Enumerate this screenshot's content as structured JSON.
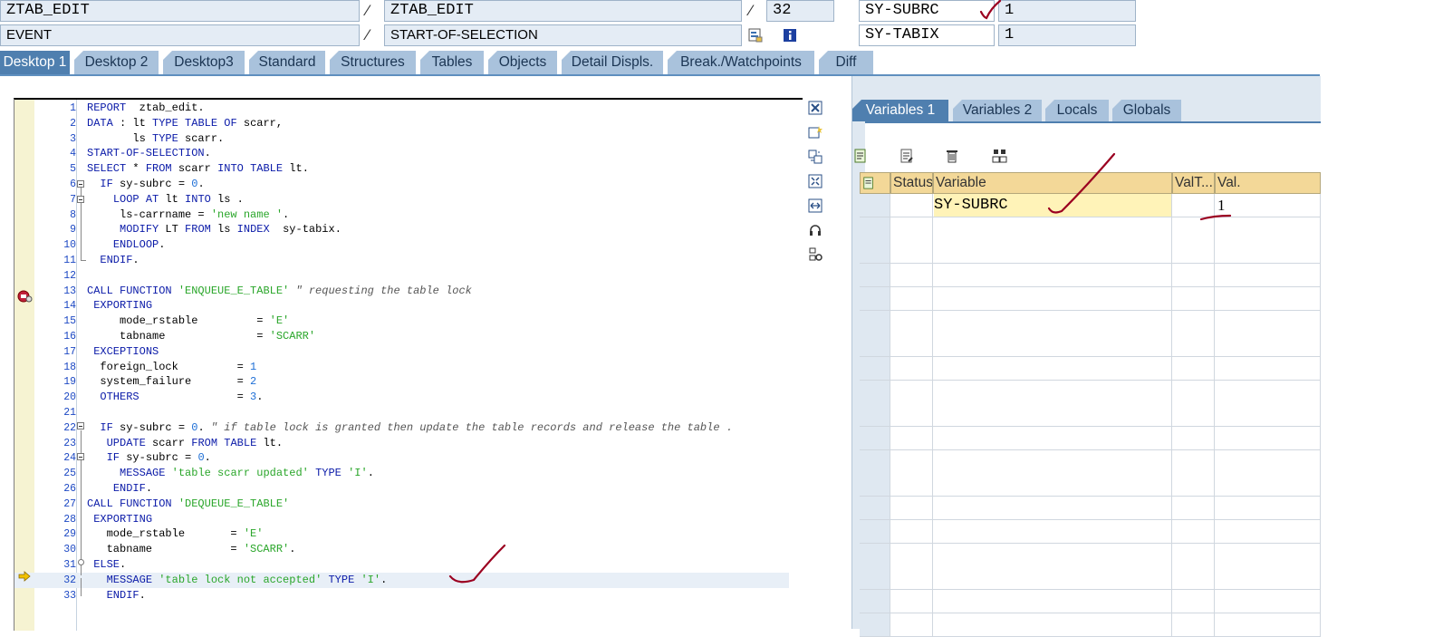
{
  "header": {
    "program_1": "ZTAB_EDIT",
    "program_2": "ZTAB_EDIT",
    "line_number": "32",
    "event_type": "EVENT",
    "event_name": "START-OF-SELECTION",
    "sysvar_1_name": "SY-SUBRC",
    "sysvar_1_value": "1",
    "sysvar_2_name": "SY-TABIX",
    "sysvar_2_value": "1"
  },
  "tabs": [
    "Desktop 1",
    "Desktop 2",
    "Desktop3",
    "Standard",
    "Structures",
    "Tables",
    "Objects",
    "Detail Displs.",
    "Break./Watchpoints",
    "Diff"
  ],
  "source": {
    "current_line": 32,
    "lines": [
      {
        "n": "1",
        "text": "REPORT  ztab_edit."
      },
      {
        "n": "2",
        "text": "DATA : lt TYPE TABLE OF scarr,"
      },
      {
        "n": "3",
        "text": "       ls TYPE scarr."
      },
      {
        "n": "4",
        "text": "START-OF-SELECTION."
      },
      {
        "n": "5",
        "text": "SELECT * FROM scarr INTO TABLE lt."
      },
      {
        "n": "6",
        "text": "  IF sy-subrc = 0."
      },
      {
        "n": "7",
        "text": "    LOOP AT lt INTO ls ."
      },
      {
        "n": "8",
        "text": "     ls-carrname = 'new name '."
      },
      {
        "n": "9",
        "text": "     MODIFY LT FROM ls INDEX  sy-tabix."
      },
      {
        "n": "10",
        "text": "    ENDLOOP."
      },
      {
        "n": "11",
        "text": "  ENDIF."
      },
      {
        "n": "12",
        "text": ""
      },
      {
        "n": "13",
        "text": "CALL FUNCTION 'ENQUEUE_E_TABLE' \" requesting the table lock"
      },
      {
        "n": "14",
        "text": " EXPORTING"
      },
      {
        "n": "15",
        "text": "     mode_rstable         = 'E'"
      },
      {
        "n": "16",
        "text": "     tabname              = 'SCARR'"
      },
      {
        "n": "17",
        "text": " EXCEPTIONS"
      },
      {
        "n": "18",
        "text": "  foreign_lock         = 1"
      },
      {
        "n": "19",
        "text": "  system_failure       = 2"
      },
      {
        "n": "20",
        "text": "  OTHERS               = 3."
      },
      {
        "n": "21",
        "text": ""
      },
      {
        "n": "22",
        "text": "  IF sy-subrc = 0. \" if table lock is granted then update the table records and release the table ."
      },
      {
        "n": "23",
        "text": "   UPDATE scarr FROM TABLE lt."
      },
      {
        "n": "24",
        "text": "   IF sy-subrc = 0."
      },
      {
        "n": "25",
        "text": "     MESSAGE 'table scarr updated' TYPE 'I'."
      },
      {
        "n": "26",
        "text": "    ENDIF."
      },
      {
        "n": "27",
        "text": "CALL FUNCTION 'DEQUEUE_E_TABLE'"
      },
      {
        "n": "28",
        "text": " EXPORTING"
      },
      {
        "n": "29",
        "text": "   mode_rstable       = 'E'"
      },
      {
        "n": "30",
        "text": "   tabname            = 'SCARR'."
      },
      {
        "n": "31",
        "text": " ELSE."
      },
      {
        "n": "32",
        "text": "   MESSAGE 'table lock not accepted' TYPE 'I'."
      },
      {
        "n": "33",
        "text": "   ENDIF."
      }
    ]
  },
  "variables": {
    "tabs": [
      "Variables 1",
      "Variables 2",
      "Locals",
      "Globals"
    ],
    "columns": {
      "status": "Status",
      "variable": "Variable",
      "valtype": "ValT...",
      "value": "Val."
    },
    "row": {
      "variable": "SY-SUBRC",
      "value": "1"
    }
  },
  "icons": {
    "header": [
      "structure-icon",
      "info-icon"
    ],
    "side_toolbar": [
      "close-icon",
      "new-variable-icon",
      "swap-icon",
      "fullscreen-icon",
      "split-icon",
      "headset-icon",
      "settings-icon"
    ],
    "grid_toolbar": [
      "detail-icon",
      "change-icon",
      "delete-icon",
      "sort-icon"
    ]
  },
  "colors": {
    "tab_active": "#4f7faf",
    "tab_inactive": "#a9c2dc",
    "field_bg": "#e4ecf5",
    "grid_header": "#f3d898",
    "selected_cell": "#fff3b8",
    "annotation": "#9b0020"
  }
}
